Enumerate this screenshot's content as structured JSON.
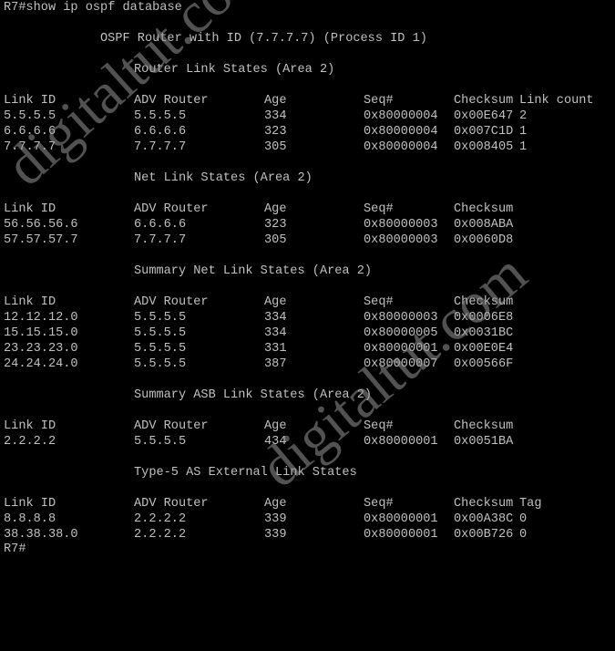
{
  "terminal": {
    "command_line": "R7#show ip ospf database",
    "header": "OSPF Router with ID (7.7.7.7) (Process ID 1)",
    "sections": [
      {
        "title": "Router Link States (Area 2)",
        "columns": [
          "Link ID",
          "ADV Router",
          "Age",
          "Seq#",
          "Checksum",
          "Link count"
        ],
        "rows": [
          [
            "5.5.5.5",
            "5.5.5.5",
            "334",
            "0x80000004",
            "0x00E647",
            "2"
          ],
          [
            "6.6.6.6",
            "6.6.6.6",
            "323",
            "0x80000004",
            "0x007C1D",
            "1"
          ],
          [
            "7.7.7.7",
            "7.7.7.7",
            "305",
            "0x80000004",
            "0x008405",
            "1"
          ]
        ]
      },
      {
        "title": "Net Link States (Area 2)",
        "columns": [
          "Link ID",
          "ADV Router",
          "Age",
          "Seq#",
          "Checksum",
          ""
        ],
        "rows": [
          [
            "56.56.56.6",
            "6.6.6.6",
            "323",
            "0x80000003",
            "0x008ABA",
            ""
          ],
          [
            "57.57.57.7",
            "7.7.7.7",
            "305",
            "0x80000003",
            "0x0060D8",
            ""
          ]
        ]
      },
      {
        "title": "Summary Net Link States (Area 2)",
        "columns": [
          "Link ID",
          "ADV Router",
          "Age",
          "Seq#",
          "Checksum",
          ""
        ],
        "rows": [
          [
            "12.12.12.0",
            "5.5.5.5",
            "334",
            "0x80000003",
            "0x0006E8",
            ""
          ],
          [
            "15.15.15.0",
            "5.5.5.5",
            "334",
            "0x80000005",
            "0x0031BC",
            ""
          ],
          [
            "23.23.23.0",
            "5.5.5.5",
            "331",
            "0x80000001",
            "0x00E0E4",
            ""
          ],
          [
            "24.24.24.0",
            "5.5.5.5",
            "387",
            "0x80000007",
            "0x00566F",
            ""
          ]
        ]
      },
      {
        "title": "Summary ASB Link States (Area 2)",
        "columns": [
          "Link ID",
          "ADV Router",
          "Age",
          "Seq#",
          "Checksum",
          ""
        ],
        "rows": [
          [
            "2.2.2.2",
            "5.5.5.5",
            "434",
            "0x80000001",
            "0x0051BA",
            ""
          ]
        ]
      },
      {
        "title": "Type-5 AS External Link States",
        "columns": [
          "Link ID",
          "ADV Router",
          "Age",
          "Seq#",
          "Checksum",
          "Tag"
        ],
        "rows": [
          [
            "8.8.8.8",
            "2.2.2.2",
            "339",
            "0x80000001",
            "0x00A38C",
            "0"
          ],
          [
            "38.38.38.0",
            "2.2.2.2",
            "339",
            "0x80000001",
            "0x00B726",
            "0"
          ]
        ]
      }
    ],
    "prompt": "R7#"
  },
  "watermark": {
    "text": "digitaltut.com"
  },
  "colors": {
    "background": "#000000",
    "text": "#c0c0c0",
    "watermark": "#969696"
  }
}
